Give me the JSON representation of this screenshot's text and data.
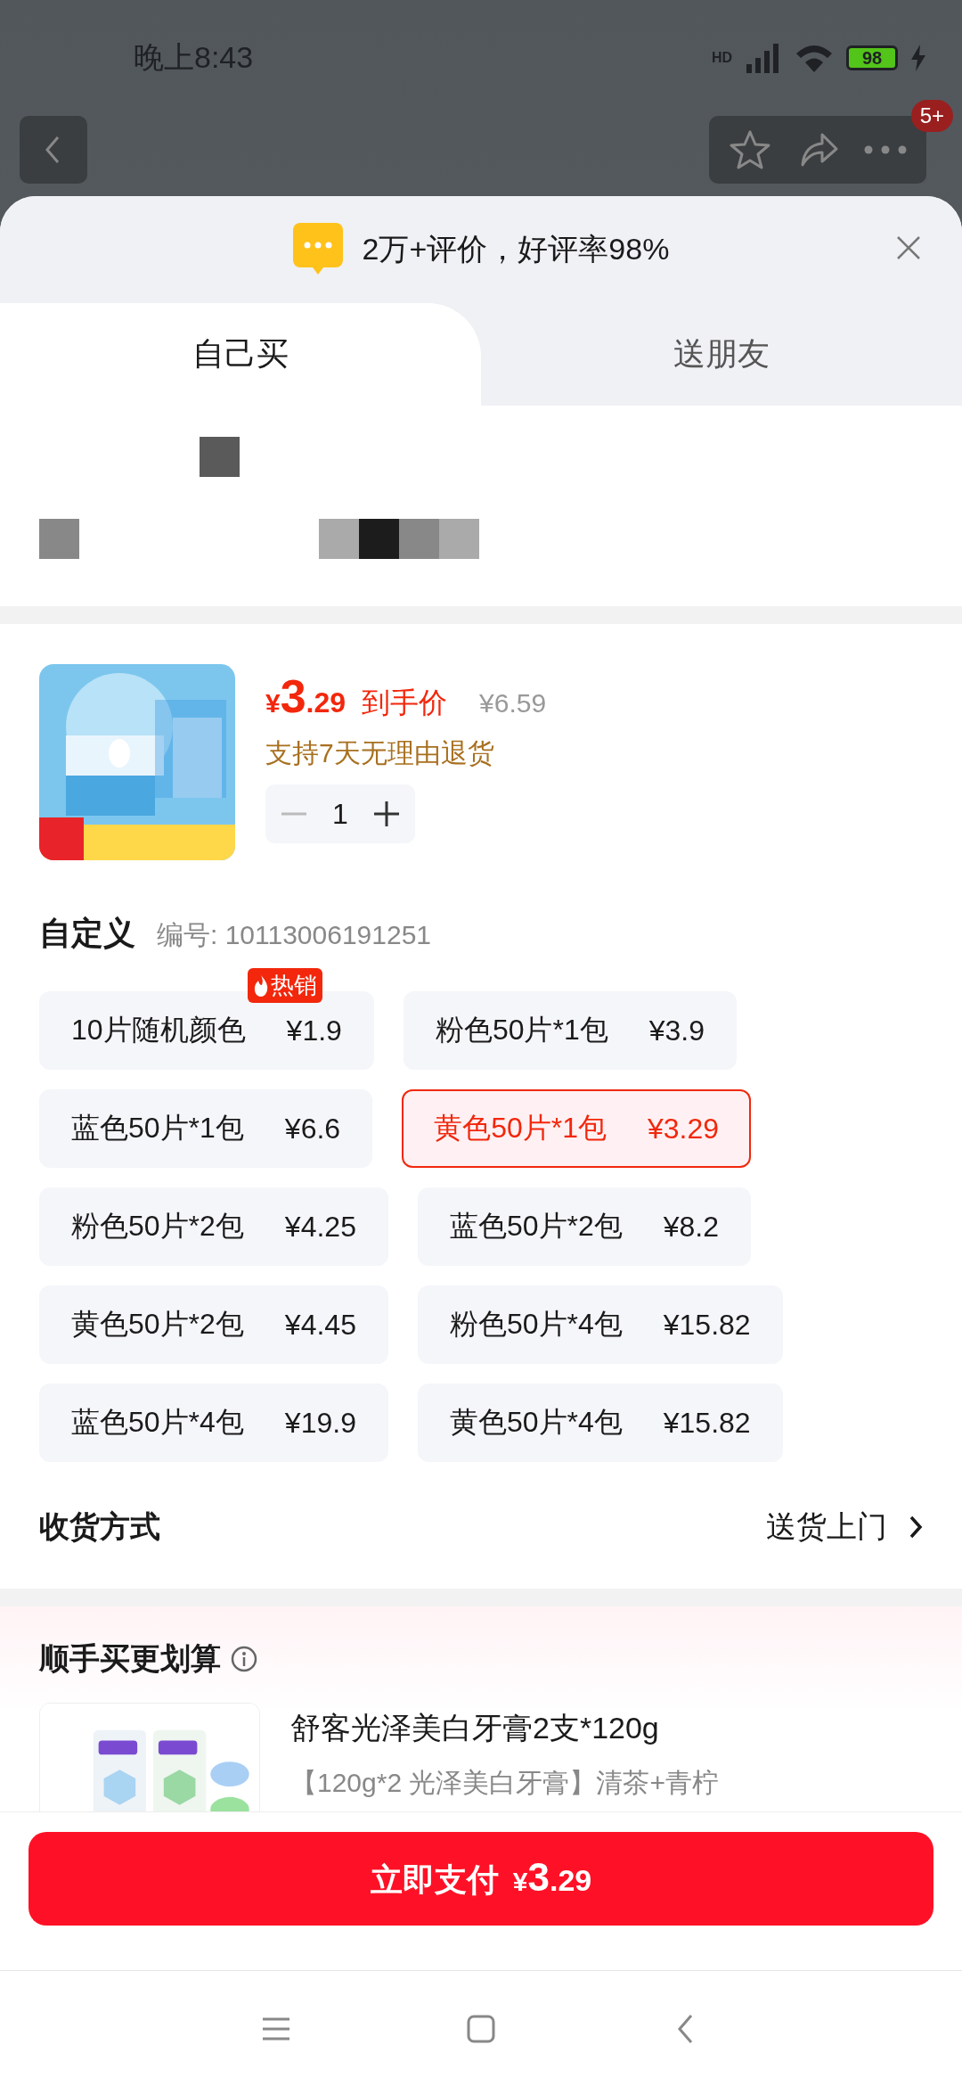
{
  "status_bar": {
    "time": "晚上8:43",
    "network": "HD",
    "battery": "98"
  },
  "nav": {
    "badge": "5+"
  },
  "review_banner": {
    "text": "2万+评价，好评率98%"
  },
  "tabs": [
    {
      "label": "自己买",
      "selected": true
    },
    {
      "label": "送朋友",
      "selected": false
    }
  ],
  "product": {
    "price_symbol": "¥",
    "price_int": "3",
    "price_dec": ".29",
    "price_label": "到手价",
    "original_price": "¥6.59",
    "return_policy": "支持7天无理由退货",
    "quantity": "1"
  },
  "spec": {
    "title": "自定义",
    "code": "编号: 10113006191251"
  },
  "options": [
    {
      "name": "10片随机颜色",
      "price": "¥1.9",
      "selected": false,
      "badge": "热销"
    },
    {
      "name": "粉色50片*1包",
      "price": "¥3.9",
      "selected": false
    },
    {
      "name": "蓝色50片*1包",
      "price": "¥6.6",
      "selected": false
    },
    {
      "name": "黄色50片*1包",
      "price": "¥3.29",
      "selected": true
    },
    {
      "name": "粉色50片*2包",
      "price": "¥4.25",
      "selected": false
    },
    {
      "name": "蓝色50片*2包",
      "price": "¥8.2",
      "selected": false
    },
    {
      "name": "黄色50片*2包",
      "price": "¥4.45",
      "selected": false
    },
    {
      "name": "粉色50片*4包",
      "price": "¥15.82",
      "selected": false
    },
    {
      "name": "蓝色50片*4包",
      "price": "¥19.9",
      "selected": false
    },
    {
      "name": "黄色50片*4包",
      "price": "¥15.82",
      "selected": false
    }
  ],
  "delivery": {
    "label": "收货方式",
    "value": "送货上门"
  },
  "addon": {
    "title": "顺手买更划算",
    "items": [
      {
        "name": "舒客光泽美白牙膏2支*120g",
        "spec": "【120g*2 光泽美白牙膏】清茶+青柠"
      }
    ]
  },
  "pay_button": {
    "label": "立即支付",
    "price_symbol": "¥",
    "price_int": "3",
    "price_dec": ".29"
  }
}
